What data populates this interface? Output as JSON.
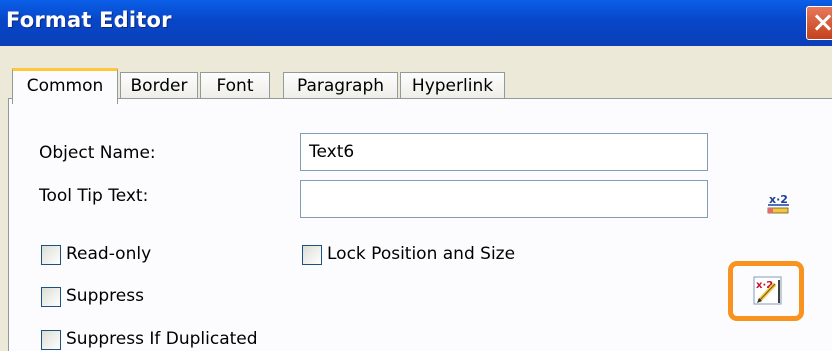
{
  "window": {
    "title": "Format Editor",
    "close_label": "✕"
  },
  "tabs": [
    {
      "label": "Common",
      "active": true
    },
    {
      "label": "Border",
      "active": false
    },
    {
      "label": "Font",
      "active": false
    },
    {
      "label": "Paragraph",
      "active": false
    },
    {
      "label": "Hyperlink",
      "active": false
    }
  ],
  "common": {
    "object_name_label": "Object Name:",
    "object_name_value": "Text6",
    "tooltip_label": "Tool Tip Text:",
    "tooltip_value": "",
    "read_only_label": "Read-only",
    "lock_label": "Lock Position and Size",
    "suppress_label": "Suppress",
    "suppress_dup_label": "Suppress If Duplicated",
    "formula_icon_top": "x·2",
    "formula_icon_bottom": "x·2"
  },
  "colors": {
    "highlight": "#f7931e",
    "titlebar": "#0846c8",
    "active_tab": "#ffc83c"
  }
}
